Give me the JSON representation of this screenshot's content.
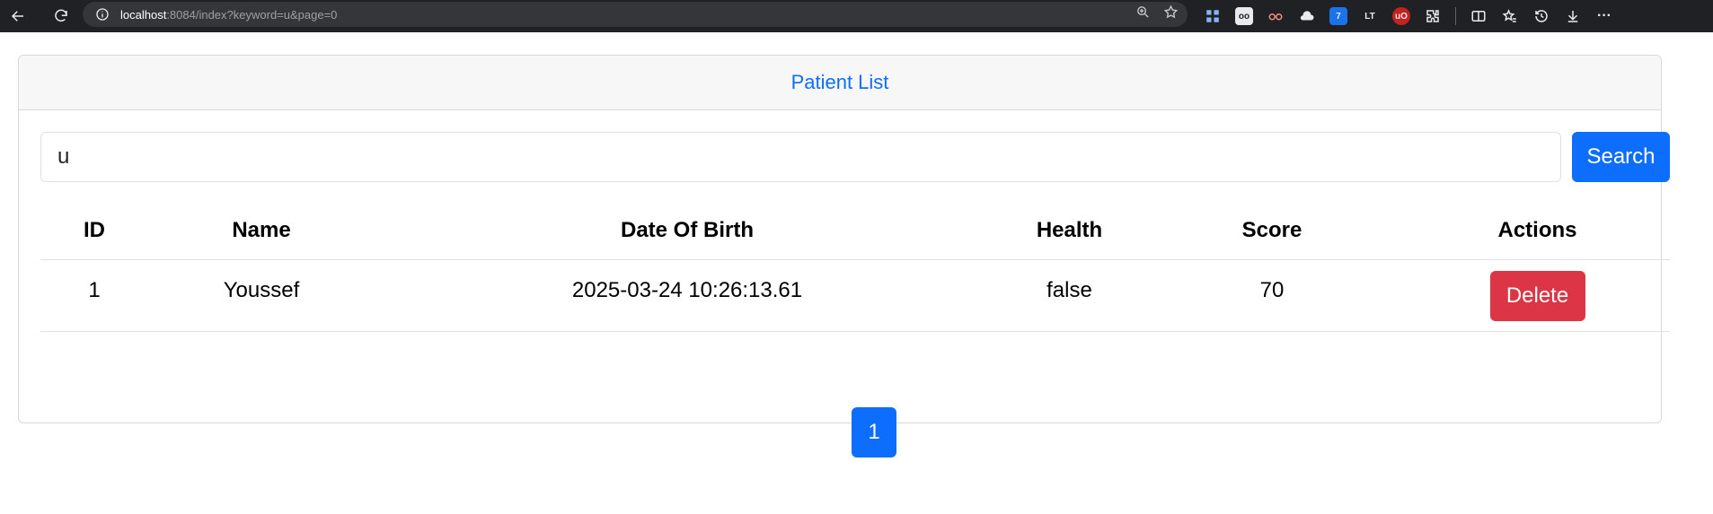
{
  "browser": {
    "url_host": "localhost",
    "url_rest": ":8084/index?keyword=u&page=0"
  },
  "card": {
    "title": "Patient List"
  },
  "search": {
    "value": "u",
    "button_label": "Search"
  },
  "table": {
    "headers": [
      "ID",
      "Name",
      "Date Of Birth",
      "Health",
      "Score",
      "Actions"
    ],
    "rows": [
      {
        "id": "1",
        "name": "Youssef",
        "dob": "2025-03-24 10:26:13.61",
        "health": "false",
        "score": "70",
        "action_label": "Delete"
      }
    ]
  },
  "pagination": {
    "current_page": "1"
  },
  "colors": {
    "primary": "#0d6efd",
    "danger": "#dc3545"
  }
}
